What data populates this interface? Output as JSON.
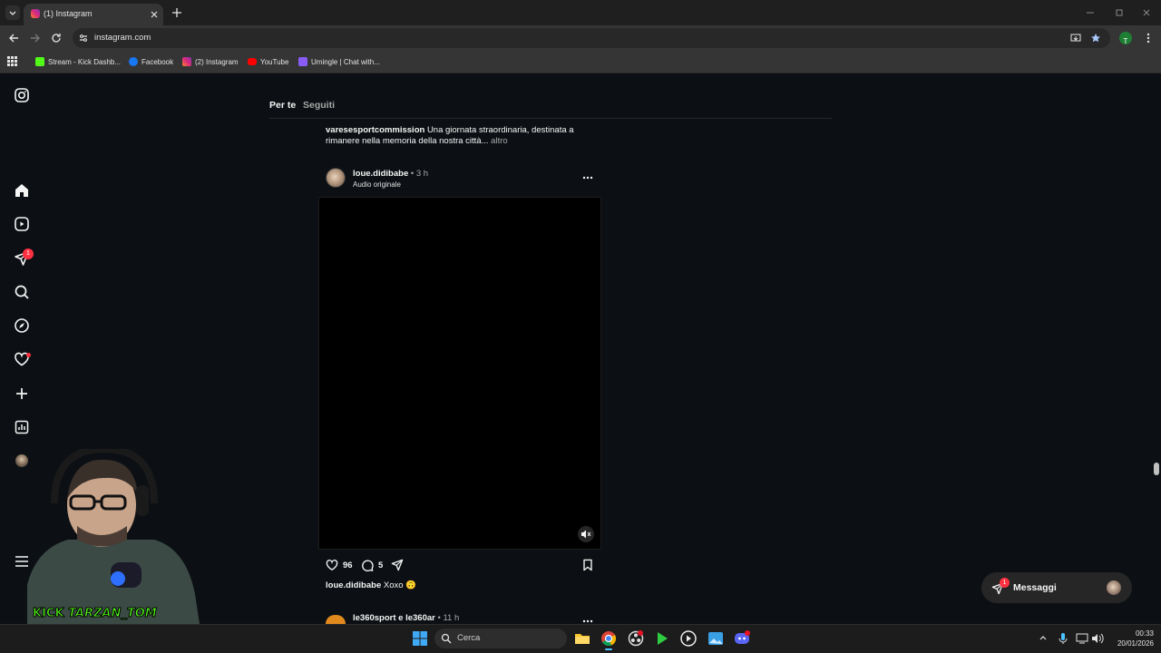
{
  "browser": {
    "tab_title": "(1) Instagram",
    "url": "instagram.com",
    "profile_initial": "T",
    "bookmarks": [
      {
        "label": "Stream - Kick Dashb...",
        "color": "#53fc18"
      },
      {
        "label": "Facebook",
        "color": "#1877f2"
      },
      {
        "label": "(2) Instagram",
        "color": "#dd2a7b"
      },
      {
        "label": "YouTube",
        "color": "#ff0000"
      },
      {
        "label": "Umingle | Chat with...",
        "color": "#8a5cf6"
      }
    ]
  },
  "instagram": {
    "sidebar": {
      "icons": [
        "instagram-logo-icon",
        "home-icon",
        "reels-icon",
        "direct-messages-icon",
        "search-icon",
        "explore-icon",
        "notifications-icon",
        "create-icon",
        "dashboard-icon",
        "profile-avatar",
        "more-menu-icon"
      ],
      "messages_badge": "1"
    },
    "feed_tabs": {
      "active": "Per te",
      "inactive": "Seguiti"
    },
    "prev_post": {
      "username": "varesesportcommission",
      "caption_line1": "Una giornata straordinaria, destinata a",
      "caption_line2": "rimanere nella memoria della nostra città...",
      "more": "altro"
    },
    "post": {
      "username": "loue.didibabe",
      "separator": "•",
      "time": "3 h",
      "audio": "Audio originale",
      "likes": "96",
      "comments": "5",
      "caption_user": "loue.didibabe",
      "caption_text": "Xoxo 🙃"
    },
    "next_post": {
      "username": "le360sport e le360ar",
      "separator": "•",
      "time": "11 h"
    },
    "messages_button": {
      "label": "Messaggi",
      "badge": "1"
    }
  },
  "overlay": {
    "kick_label": "KICK",
    "channel": "TARZAN_TOM"
  },
  "taskbar": {
    "search_placeholder": "Cerca",
    "time": "00:33",
    "date": "20/01/2026"
  },
  "colors": {
    "ig_background": "#0c1014",
    "notification_red": "#ff3040",
    "kick_green": "#53fc18"
  }
}
